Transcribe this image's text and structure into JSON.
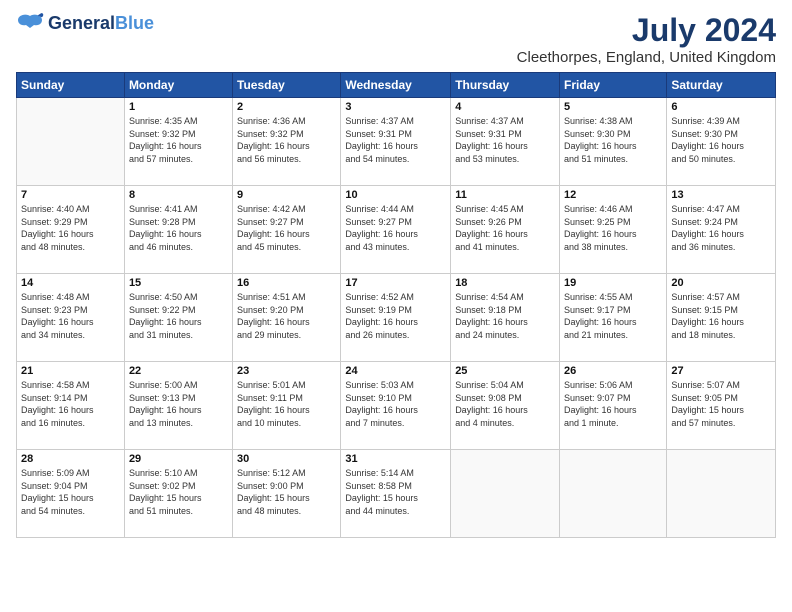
{
  "header": {
    "logo_line1": "General",
    "logo_line2": "Blue",
    "month_year": "July 2024",
    "location": "Cleethorpes, England, United Kingdom"
  },
  "days_of_week": [
    "Sunday",
    "Monday",
    "Tuesday",
    "Wednesday",
    "Thursday",
    "Friday",
    "Saturday"
  ],
  "weeks": [
    [
      {
        "day": "",
        "info": ""
      },
      {
        "day": "1",
        "info": "Sunrise: 4:35 AM\nSunset: 9:32 PM\nDaylight: 16 hours\nand 57 minutes."
      },
      {
        "day": "2",
        "info": "Sunrise: 4:36 AM\nSunset: 9:32 PM\nDaylight: 16 hours\nand 56 minutes."
      },
      {
        "day": "3",
        "info": "Sunrise: 4:37 AM\nSunset: 9:31 PM\nDaylight: 16 hours\nand 54 minutes."
      },
      {
        "day": "4",
        "info": "Sunrise: 4:37 AM\nSunset: 9:31 PM\nDaylight: 16 hours\nand 53 minutes."
      },
      {
        "day": "5",
        "info": "Sunrise: 4:38 AM\nSunset: 9:30 PM\nDaylight: 16 hours\nand 51 minutes."
      },
      {
        "day": "6",
        "info": "Sunrise: 4:39 AM\nSunset: 9:30 PM\nDaylight: 16 hours\nand 50 minutes."
      }
    ],
    [
      {
        "day": "7",
        "info": "Sunrise: 4:40 AM\nSunset: 9:29 PM\nDaylight: 16 hours\nand 48 minutes."
      },
      {
        "day": "8",
        "info": "Sunrise: 4:41 AM\nSunset: 9:28 PM\nDaylight: 16 hours\nand 46 minutes."
      },
      {
        "day": "9",
        "info": "Sunrise: 4:42 AM\nSunset: 9:27 PM\nDaylight: 16 hours\nand 45 minutes."
      },
      {
        "day": "10",
        "info": "Sunrise: 4:44 AM\nSunset: 9:27 PM\nDaylight: 16 hours\nand 43 minutes."
      },
      {
        "day": "11",
        "info": "Sunrise: 4:45 AM\nSunset: 9:26 PM\nDaylight: 16 hours\nand 41 minutes."
      },
      {
        "day": "12",
        "info": "Sunrise: 4:46 AM\nSunset: 9:25 PM\nDaylight: 16 hours\nand 38 minutes."
      },
      {
        "day": "13",
        "info": "Sunrise: 4:47 AM\nSunset: 9:24 PM\nDaylight: 16 hours\nand 36 minutes."
      }
    ],
    [
      {
        "day": "14",
        "info": "Sunrise: 4:48 AM\nSunset: 9:23 PM\nDaylight: 16 hours\nand 34 minutes."
      },
      {
        "day": "15",
        "info": "Sunrise: 4:50 AM\nSunset: 9:22 PM\nDaylight: 16 hours\nand 31 minutes."
      },
      {
        "day": "16",
        "info": "Sunrise: 4:51 AM\nSunset: 9:20 PM\nDaylight: 16 hours\nand 29 minutes."
      },
      {
        "day": "17",
        "info": "Sunrise: 4:52 AM\nSunset: 9:19 PM\nDaylight: 16 hours\nand 26 minutes."
      },
      {
        "day": "18",
        "info": "Sunrise: 4:54 AM\nSunset: 9:18 PM\nDaylight: 16 hours\nand 24 minutes."
      },
      {
        "day": "19",
        "info": "Sunrise: 4:55 AM\nSunset: 9:17 PM\nDaylight: 16 hours\nand 21 minutes."
      },
      {
        "day": "20",
        "info": "Sunrise: 4:57 AM\nSunset: 9:15 PM\nDaylight: 16 hours\nand 18 minutes."
      }
    ],
    [
      {
        "day": "21",
        "info": "Sunrise: 4:58 AM\nSunset: 9:14 PM\nDaylight: 16 hours\nand 16 minutes."
      },
      {
        "day": "22",
        "info": "Sunrise: 5:00 AM\nSunset: 9:13 PM\nDaylight: 16 hours\nand 13 minutes."
      },
      {
        "day": "23",
        "info": "Sunrise: 5:01 AM\nSunset: 9:11 PM\nDaylight: 16 hours\nand 10 minutes."
      },
      {
        "day": "24",
        "info": "Sunrise: 5:03 AM\nSunset: 9:10 PM\nDaylight: 16 hours\nand 7 minutes."
      },
      {
        "day": "25",
        "info": "Sunrise: 5:04 AM\nSunset: 9:08 PM\nDaylight: 16 hours\nand 4 minutes."
      },
      {
        "day": "26",
        "info": "Sunrise: 5:06 AM\nSunset: 9:07 PM\nDaylight: 16 hours\nand 1 minute."
      },
      {
        "day": "27",
        "info": "Sunrise: 5:07 AM\nSunset: 9:05 PM\nDaylight: 15 hours\nand 57 minutes."
      }
    ],
    [
      {
        "day": "28",
        "info": "Sunrise: 5:09 AM\nSunset: 9:04 PM\nDaylight: 15 hours\nand 54 minutes."
      },
      {
        "day": "29",
        "info": "Sunrise: 5:10 AM\nSunset: 9:02 PM\nDaylight: 15 hours\nand 51 minutes."
      },
      {
        "day": "30",
        "info": "Sunrise: 5:12 AM\nSunset: 9:00 PM\nDaylight: 15 hours\nand 48 minutes."
      },
      {
        "day": "31",
        "info": "Sunrise: 5:14 AM\nSunset: 8:58 PM\nDaylight: 15 hours\nand 44 minutes."
      },
      {
        "day": "",
        "info": ""
      },
      {
        "day": "",
        "info": ""
      },
      {
        "day": "",
        "info": ""
      }
    ]
  ]
}
